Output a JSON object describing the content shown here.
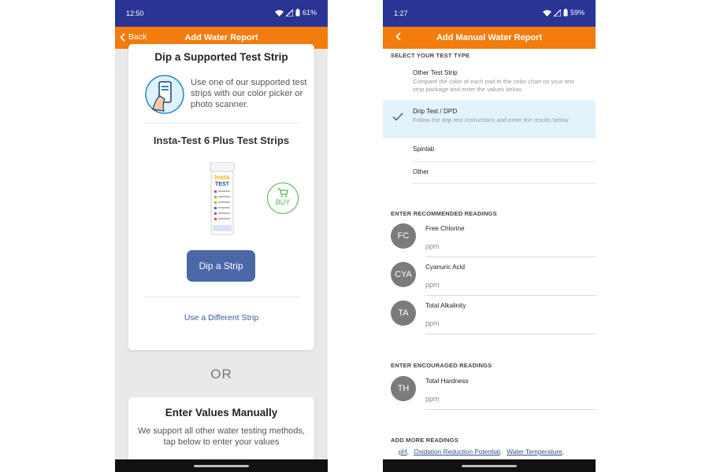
{
  "left": {
    "status": {
      "time": "12:50",
      "battery": "61%"
    },
    "appbar": {
      "back_label": "Back",
      "title": "Add Water Report"
    },
    "top_card": {
      "heading": "Dip a Supported Test Strip",
      "intro": "Use one of our supported test strips with our color picker or photo scanner.",
      "strip_name": "Insta-Test 6 Plus Test Strips",
      "buy_label": "BUY",
      "dip_button": "Dip a Strip",
      "different_strip": "Use a Different Strip",
      "bottle_logo_1": "Insta",
      "bottle_logo_2": "TEST"
    },
    "or_text": "OR",
    "bottom_card": {
      "heading": "Enter Values Manually",
      "description": "We support all other water testing methods, tap below to enter your values"
    }
  },
  "right": {
    "status": {
      "time": "1:27",
      "battery": "59%"
    },
    "appbar": {
      "title": "Add Manual Water Report"
    },
    "test_type_header": "SELECT YOUR TEST TYPE",
    "test_types": [
      {
        "name": "Other Test Strip",
        "desc": "Compare the color of each pad to the color chart on your test strip package and enter the values below",
        "selected": false
      },
      {
        "name": "Drip Test / DPD",
        "desc": "Follow the drip test instructions and enter the results below",
        "selected": true
      },
      {
        "name": "Spinlab",
        "desc": "",
        "selected": false
      },
      {
        "name": "Other",
        "desc": "",
        "selected": false
      }
    ],
    "recommended_header": "ENTER RECOMMENDED READINGS",
    "recommended": [
      {
        "abbr": "FC",
        "label": "Free Chlorine",
        "unit": "ppm"
      },
      {
        "abbr": "CYA",
        "label": "Cyanuric Acid",
        "unit": "ppm"
      },
      {
        "abbr": "TA",
        "label": "Total Alkalinity",
        "unit": "ppm"
      }
    ],
    "encouraged_header": "ENTER ENCOURAGED READINGS",
    "encouraged": [
      {
        "abbr": "TH",
        "label": "Total Hardness",
        "unit": "ppm"
      }
    ],
    "more_header": "ADD MORE READINGS",
    "more_links": [
      "pH",
      "Oxidation Reduction Potential",
      "Water Temperature"
    ]
  },
  "colors": {
    "status_bar": "#283593",
    "app_bar": "#f27c0c",
    "primary_button": "#4a67a6",
    "buy_green": "#4caf50",
    "selected_row": "#e3f3fb",
    "avatar_gray": "#7b7b7b"
  },
  "icons": [
    "wifi-icon",
    "signal-icon",
    "battery-icon",
    "back-chevron-icon",
    "phone-in-hand-icon",
    "cart-icon",
    "checkmark-icon"
  ]
}
